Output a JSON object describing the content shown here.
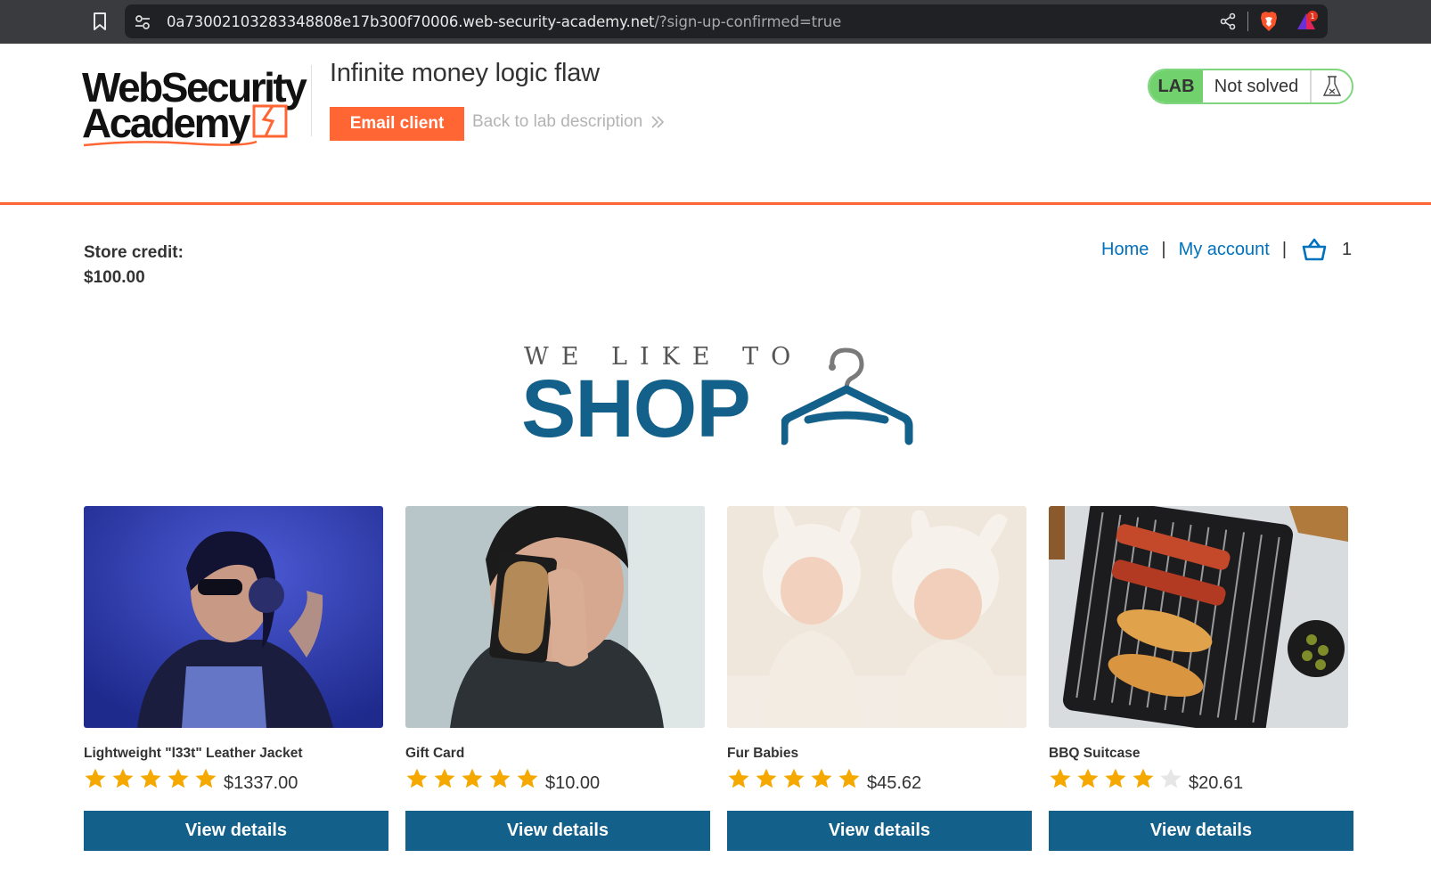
{
  "browser": {
    "url_host": "0a73002103283348808e17b300f70006.web-security-academy.net",
    "url_path": "/?sign-up-confirmed=true",
    "rewards_count": "1"
  },
  "lab_header": {
    "logo_line1": "WebSecurity",
    "logo_line2": "Academy",
    "title": "Infinite money logic flaw",
    "email_client_label": "Email client",
    "back_link_label": "Back to lab description",
    "lab_badge": "LAB",
    "status": "Not solved",
    "accent_color": "#ff6633",
    "status_color": "#70d16d"
  },
  "store": {
    "credit_label": "Store credit:",
    "credit_value": "$100.00"
  },
  "nav": {
    "home": "Home",
    "separator": "|",
    "my_account": "My account",
    "cart_count": "1",
    "link_color": "#0071bc"
  },
  "banner": {
    "small_text": "WE LIKE TO",
    "big_text": "SHOP",
    "brand_color": "#13618a"
  },
  "products": [
    {
      "name": "Lightweight \"l33t\" Leather Jacket",
      "rating": 5,
      "price": "$1337.00",
      "button": "View details",
      "image": "woman-headphones-photo"
    },
    {
      "name": "Gift Card",
      "rating": 5,
      "price": "$10.00",
      "button": "View details",
      "image": "person-holding-card-photo"
    },
    {
      "name": "Fur Babies",
      "rating": 5,
      "price": "$45.62",
      "button": "View details",
      "image": "babies-bunny-hats-photo"
    },
    {
      "name": "BBQ Suitcase",
      "rating": 4,
      "price": "$20.61",
      "button": "View details",
      "image": "bbq-grill-photo"
    }
  ]
}
